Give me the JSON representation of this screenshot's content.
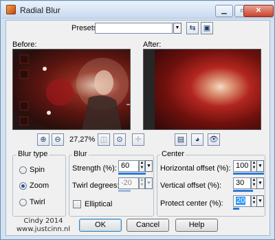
{
  "window": {
    "title": "Radial Blur"
  },
  "presets": {
    "label": "Presets:",
    "value": ""
  },
  "preview": {
    "before_label": "Before:",
    "after_label": "After:",
    "zoom": "27,27%"
  },
  "blur_type": {
    "title": "Blur type",
    "options": [
      "Spin",
      "Zoom",
      "Twirl"
    ],
    "selected": "Zoom"
  },
  "blur": {
    "title": "Blur",
    "strength_label": "Strength (%):",
    "strength": "60",
    "strength_level": 0.6,
    "twirl_label": "Twirl degrees:",
    "twirl": "-20",
    "elliptical_label": "Elliptical"
  },
  "center": {
    "title": "Center",
    "h_offset_label": "Horizontal offset (%):",
    "h_offset": "100",
    "h_level": 1.0,
    "v_offset_label": "Vertical offset (%):",
    "v_offset": "30",
    "v_level": 0.65,
    "protect_label": "Protect center (%):",
    "protect": "20",
    "protect_level": 0.2
  },
  "buttons": {
    "ok": "OK",
    "cancel": "Cancel",
    "help": "Help"
  },
  "watermark": {
    "line1": "Cindy 2014",
    "line2": "www.justcinn.nl"
  },
  "colors": {
    "accent": "#2b7ad6",
    "title_bar": "#c9daef",
    "close": "#c8432d"
  }
}
